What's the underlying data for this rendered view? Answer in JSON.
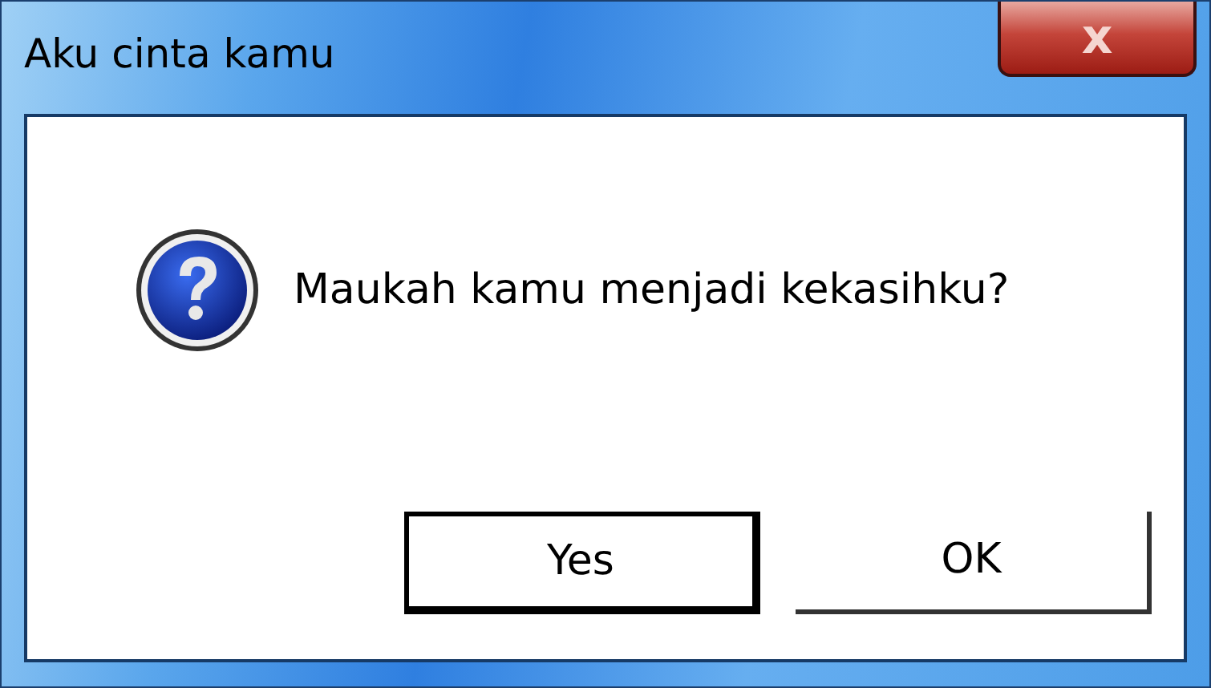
{
  "window": {
    "title": "Aku cinta kamu",
    "close_label": "x"
  },
  "message": "Maukah kamu menjadi kekasihku?",
  "buttons": [
    {
      "label": "Yes",
      "default": true
    },
    {
      "label": "OK",
      "default": false
    }
  ]
}
